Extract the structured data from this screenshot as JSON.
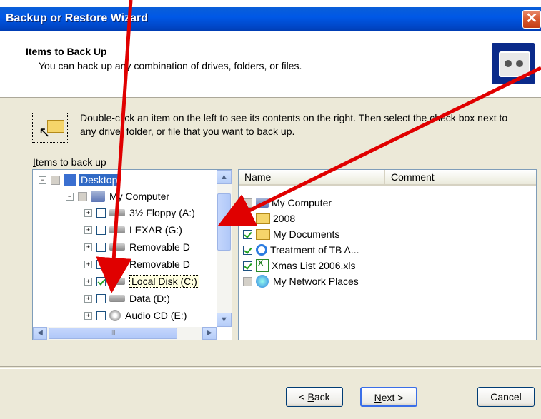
{
  "window": {
    "title": "Backup or Restore Wizard",
    "close_symbol": "✕"
  },
  "header": {
    "title": "Items to Back Up",
    "subtitle": "You can back up any combination of drives, folders, or files."
  },
  "instructions": "Double-click an item on the left to see its contents on the right. Then select the check box next to any drive, folder, or file that you want to back up.",
  "items_label": {
    "prefix": "I",
    "rest": "tems to back up"
  },
  "tree": {
    "items": [
      {
        "label": "Desktop",
        "expander": "−",
        "check": "gray"
      },
      {
        "label": "My Computer",
        "expander": "−",
        "check": "gray"
      },
      {
        "label": "3½ Floppy (A:)",
        "expander": "+",
        "check": "empty"
      },
      {
        "label": "LEXAR (G:)",
        "expander": "+",
        "check": "empty"
      },
      {
        "label": "Removable D",
        "expander": "+",
        "check": "empty"
      },
      {
        "label": "Removable D",
        "expander": "+",
        "check": "empty"
      },
      {
        "label": "Local Disk (C:)",
        "expander": "+",
        "check": "checked"
      },
      {
        "label": "Data (D:)",
        "expander": "+",
        "check": "empty"
      },
      {
        "label": "Audio CD (E:)",
        "expander": "+",
        "check": "empty"
      }
    ],
    "scroll_up": "▲",
    "scroll_down": "▼",
    "scroll_left": "◀",
    "scroll_right": "▶",
    "thumb_grip": "III"
  },
  "list": {
    "columns": [
      "Name",
      "Comment"
    ],
    "rows": [
      {
        "label": "My Computer",
        "check": "gray"
      },
      {
        "label": "2008",
        "check": "checked"
      },
      {
        "label": "My Documents",
        "check": "checked"
      },
      {
        "label": "Treatment of TB A...",
        "check": "checked"
      },
      {
        "label": "Xmas List 2006.xls",
        "check": "checked"
      },
      {
        "label": "My Network Places",
        "check": "gray"
      }
    ]
  },
  "buttons": {
    "back": {
      "mnemonic": "B",
      "rest": "ack",
      "prefix": "< "
    },
    "next": {
      "mnemonic": "N",
      "rest": "ext >"
    },
    "cancel": "Cancel"
  },
  "colors": {
    "annotation_arrow": "#e00000",
    "titlebar": "#0058e6",
    "selection": "#316ac5"
  }
}
